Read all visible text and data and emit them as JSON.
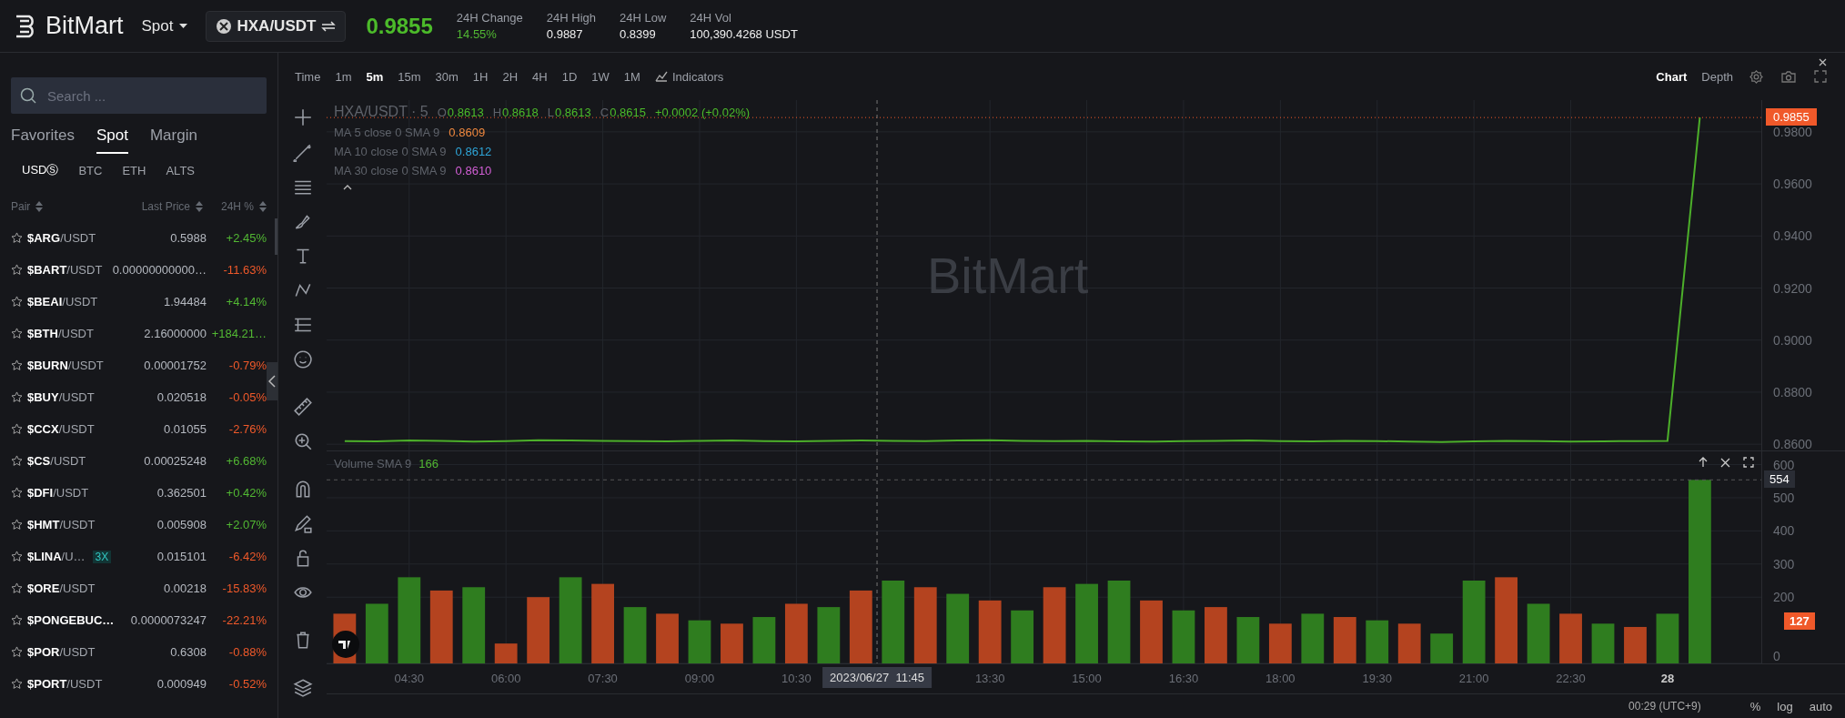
{
  "header": {
    "logo": "BitMart",
    "market": "Spot",
    "pair": "HXA/USDT",
    "last_price": "0.9855",
    "stats": [
      {
        "label": "24H Change",
        "value": "14.55%",
        "kind": "up"
      },
      {
        "label": "24H High",
        "value": "0.9887",
        "kind": "plain"
      },
      {
        "label": "24H Low",
        "value": "0.8399",
        "kind": "plain"
      },
      {
        "label": "24H Vol",
        "value": "100,390.4268 USDT",
        "kind": "plain"
      }
    ]
  },
  "sidebar": {
    "search": {
      "placeholder": "Search ..."
    },
    "tabs": [
      {
        "label": "Favorites",
        "selected": false
      },
      {
        "label": "Spot",
        "selected": true
      },
      {
        "label": "Margin",
        "selected": false
      }
    ],
    "quote_tabs": [
      {
        "label": "USDⓈ",
        "selected": true
      },
      {
        "label": "BTC",
        "selected": false
      },
      {
        "label": "ETH",
        "selected": false
      },
      {
        "label": "ALTS",
        "selected": false
      }
    ],
    "columns": [
      "Pair",
      "Last Price",
      "24H %"
    ],
    "rows": [
      {
        "base": "$ARG",
        "quote": "/USDT",
        "price": "0.5988",
        "change": "+2.45%",
        "kind": "up"
      },
      {
        "base": "$BART",
        "quote": "/USDT",
        "price": "0.00000000000…",
        "change": "-11.63%",
        "kind": "down"
      },
      {
        "base": "$BEAI",
        "quote": "/USDT",
        "price": "1.94484",
        "change": "+4.14%",
        "kind": "up"
      },
      {
        "base": "$BTH",
        "quote": "/USDT",
        "price": "2.16000000",
        "change": "+184.21…",
        "kind": "up"
      },
      {
        "base": "$BURN",
        "quote": "/USDT",
        "price": "0.00001752",
        "change": "-0.79%",
        "kind": "down"
      },
      {
        "base": "$BUY",
        "quote": "/USDT",
        "price": "0.020518",
        "change": "-0.05%",
        "kind": "down"
      },
      {
        "base": "$CCX",
        "quote": "/USDT",
        "price": "0.01055",
        "change": "-2.76%",
        "kind": "down"
      },
      {
        "base": "$CS",
        "quote": "/USDT",
        "price": "0.00025248",
        "change": "+6.68%",
        "kind": "up"
      },
      {
        "base": "$DFI",
        "quote": "/USDT",
        "price": "0.362501",
        "change": "+0.42%",
        "kind": "up"
      },
      {
        "base": "$HMT",
        "quote": "/USDT",
        "price": "0.005908",
        "change": "+2.07%",
        "kind": "up"
      },
      {
        "base": "$LINA",
        "quote": "/U…",
        "badge": "3X",
        "price": "0.015101",
        "change": "-6.42%",
        "kind": "down"
      },
      {
        "base": "$ORE",
        "quote": "/USDT",
        "price": "0.00218",
        "change": "-15.83%",
        "kind": "down"
      },
      {
        "base": "$PONGEBUC…",
        "price": "0.0000073247",
        "change": "-22.21%",
        "kind": "down"
      },
      {
        "base": "$POR",
        "quote": "/USDT",
        "price": "0.6308",
        "change": "-0.88%",
        "kind": "down"
      },
      {
        "base": "$PORT",
        "quote": "/USDT",
        "price": "0.000949",
        "change": "-0.52%",
        "kind": "down"
      }
    ]
  },
  "chart_toolbar": {
    "intervals": [
      {
        "label": "Time",
        "selected": false
      },
      {
        "label": "1m",
        "selected": false
      },
      {
        "label": "5m",
        "selected": true
      },
      {
        "label": "15m",
        "selected": false
      },
      {
        "label": "30m",
        "selected": false
      },
      {
        "label": "1H",
        "selected": false
      },
      {
        "label": "2H",
        "selected": false
      },
      {
        "label": "4H",
        "selected": false
      },
      {
        "label": "1D",
        "selected": false
      },
      {
        "label": "1W",
        "selected": false
      },
      {
        "label": "1M",
        "selected": false
      }
    ],
    "indicators": "Indicators",
    "views": [
      {
        "label": "Chart",
        "selected": true
      },
      {
        "label": "Depth",
        "selected": false
      }
    ]
  },
  "price_pane": {
    "symbol": "HXA/USDT · 5",
    "ohlc": [
      {
        "key": "O",
        "value": "0.8613"
      },
      {
        "key": "H",
        "value": "0.8618"
      },
      {
        "key": "L",
        "value": "0.8613"
      },
      {
        "key": "C",
        "value": "0.8615"
      }
    ],
    "change": "+0.0002 (+0.02%)",
    "moving_averages": [
      {
        "label": "MA 5 close 0 SMA 9",
        "value": "0.8609",
        "color": "#f0883e"
      },
      {
        "label": "MA 10 close 0 SMA 9",
        "value": "0.8612",
        "color": "#2ea5d8"
      },
      {
        "label": "MA 30 close 0 SMA 9",
        "value": "0.8610",
        "color": "#d35fd6"
      }
    ],
    "watermark": "BitMart",
    "last_price_label": "0.9855",
    "chart_data": {
      "type": "line",
      "grid": true,
      "xlim": [
        3.22,
        26.75
      ],
      "ylim": [
        0.8576,
        0.9922
      ],
      "ref_lines": [
        {
          "axis": "y",
          "value": 0.9855,
          "color": "#f0592a"
        },
        {
          "axis": "x",
          "value": 11.75,
          "color": "#777777"
        }
      ],
      "yticks": [
        {
          "value": 0.86,
          "label": "0.8600"
        },
        {
          "value": 0.88,
          "label": "0.8800"
        },
        {
          "value": 0.9,
          "label": "0.9000"
        },
        {
          "value": 0.92,
          "label": "0.9200"
        },
        {
          "value": 0.94,
          "label": "0.9400"
        },
        {
          "value": 0.96,
          "label": "0.9600"
        },
        {
          "value": 0.98,
          "label": "0.9800"
        }
      ],
      "x": [
        3.5,
        4,
        4.5,
        5,
        5.5,
        6,
        6.5,
        7,
        7.5,
        8,
        8.5,
        9,
        9.5,
        10,
        10.5,
        11,
        11.5,
        12,
        12.5,
        13,
        13.5,
        14,
        14.5,
        15,
        15.5,
        16,
        16.5,
        17,
        17.5,
        18,
        18.5,
        19,
        19.5,
        20,
        20.5,
        21,
        21.5,
        22,
        22.5,
        23,
        23.5,
        24,
        24.5
      ],
      "series": [
        {
          "color": "#4caf2a",
          "values": [
            0.8612,
            0.8611,
            0.8614,
            0.8613,
            0.861,
            0.8612,
            0.8615,
            0.8614,
            0.8613,
            0.8612,
            0.8611,
            0.8613,
            0.8614,
            0.8612,
            0.8611,
            0.8613,
            0.8614,
            0.8613,
            0.8612,
            0.8614,
            0.8615,
            0.8613,
            0.8612,
            0.8613,
            0.8611,
            0.861,
            0.8612,
            0.8613,
            0.8614,
            0.8612,
            0.8611,
            0.8613,
            0.8612,
            0.861,
            0.8608,
            0.8611,
            0.8613,
            0.8612,
            0.861,
            0.8611,
            0.8612,
            0.8613,
            0.9855
          ]
        }
      ]
    }
  },
  "volume_pane": {
    "label": "Volume SMA 9",
    "value": "166",
    "current_label": "554",
    "last_label": "127",
    "chart_data": {
      "type": "bar",
      "stacked": true,
      "grid": true,
      "xlim": [
        3.22,
        26.75
      ],
      "ylim": [
        0,
        640
      ],
      "yticks": [
        0,
        200,
        300,
        400,
        500,
        600
      ],
      "ref_lines": [
        {
          "axis": "y",
          "value": 554,
          "color": "#555555"
        },
        {
          "axis": "x",
          "value": 11.75,
          "color": "#777777"
        }
      ],
      "xticks": [
        {
          "value": 4.5,
          "label": "04:30"
        },
        {
          "value": 6,
          "label": "06:00"
        },
        {
          "value": 7.5,
          "label": "07:30"
        },
        {
          "value": 9,
          "label": "09:00"
        },
        {
          "value": 10.5,
          "label": "10:30"
        },
        {
          "value": 13.5,
          "label": "13:30"
        },
        {
          "value": 15,
          "label": "15:00"
        },
        {
          "value": 16.5,
          "label": "16:30"
        },
        {
          "value": 18,
          "label": "18:00"
        },
        {
          "value": 19.5,
          "label": "19:30"
        },
        {
          "value": 21,
          "label": "21:00"
        },
        {
          "value": 22.5,
          "label": "22:30"
        }
      ],
      "x": [
        3.5,
        4,
        4.5,
        5,
        5.5,
        6,
        6.5,
        7,
        7.5,
        8,
        8.5,
        9,
        9.5,
        10,
        10.5,
        11,
        11.5,
        12,
        12.5,
        13,
        13.5,
        14,
        14.5,
        15,
        15.5,
        16,
        16.5,
        17,
        17.5,
        18,
        18.5,
        19,
        19.5,
        20,
        20.5,
        21,
        21.5,
        22,
        22.5,
        23,
        23.5,
        24,
        24.5
      ],
      "series": [
        {
          "color": "#2f7d1f",
          "values": [
            null,
            180,
            260,
            null,
            230,
            null,
            null,
            260,
            null,
            170,
            null,
            130,
            null,
            140,
            null,
            170,
            null,
            250,
            null,
            210,
            null,
            160,
            null,
            240,
            250,
            null,
            160,
            null,
            140,
            null,
            150,
            null,
            130,
            null,
            90,
            250,
            null,
            180,
            null,
            120,
            null,
            150,
            554
          ]
        },
        {
          "color": "#b4431f",
          "values": [
            150,
            null,
            null,
            220,
            null,
            60,
            200,
            null,
            240,
            null,
            150,
            null,
            120,
            null,
            180,
            null,
            220,
            null,
            230,
            null,
            190,
            null,
            230,
            null,
            null,
            190,
            null,
            170,
            null,
            120,
            null,
            140,
            null,
            120,
            null,
            null,
            260,
            null,
            150,
            null,
            110,
            null,
            null
          ]
        }
      ]
    }
  },
  "day_label": "28",
  "crosshair_label": "2023/06/27  11:45",
  "status_bar": {
    "timezone": "00:29 (UTC+9)",
    "options": [
      "%",
      "log",
      "auto"
    ]
  }
}
